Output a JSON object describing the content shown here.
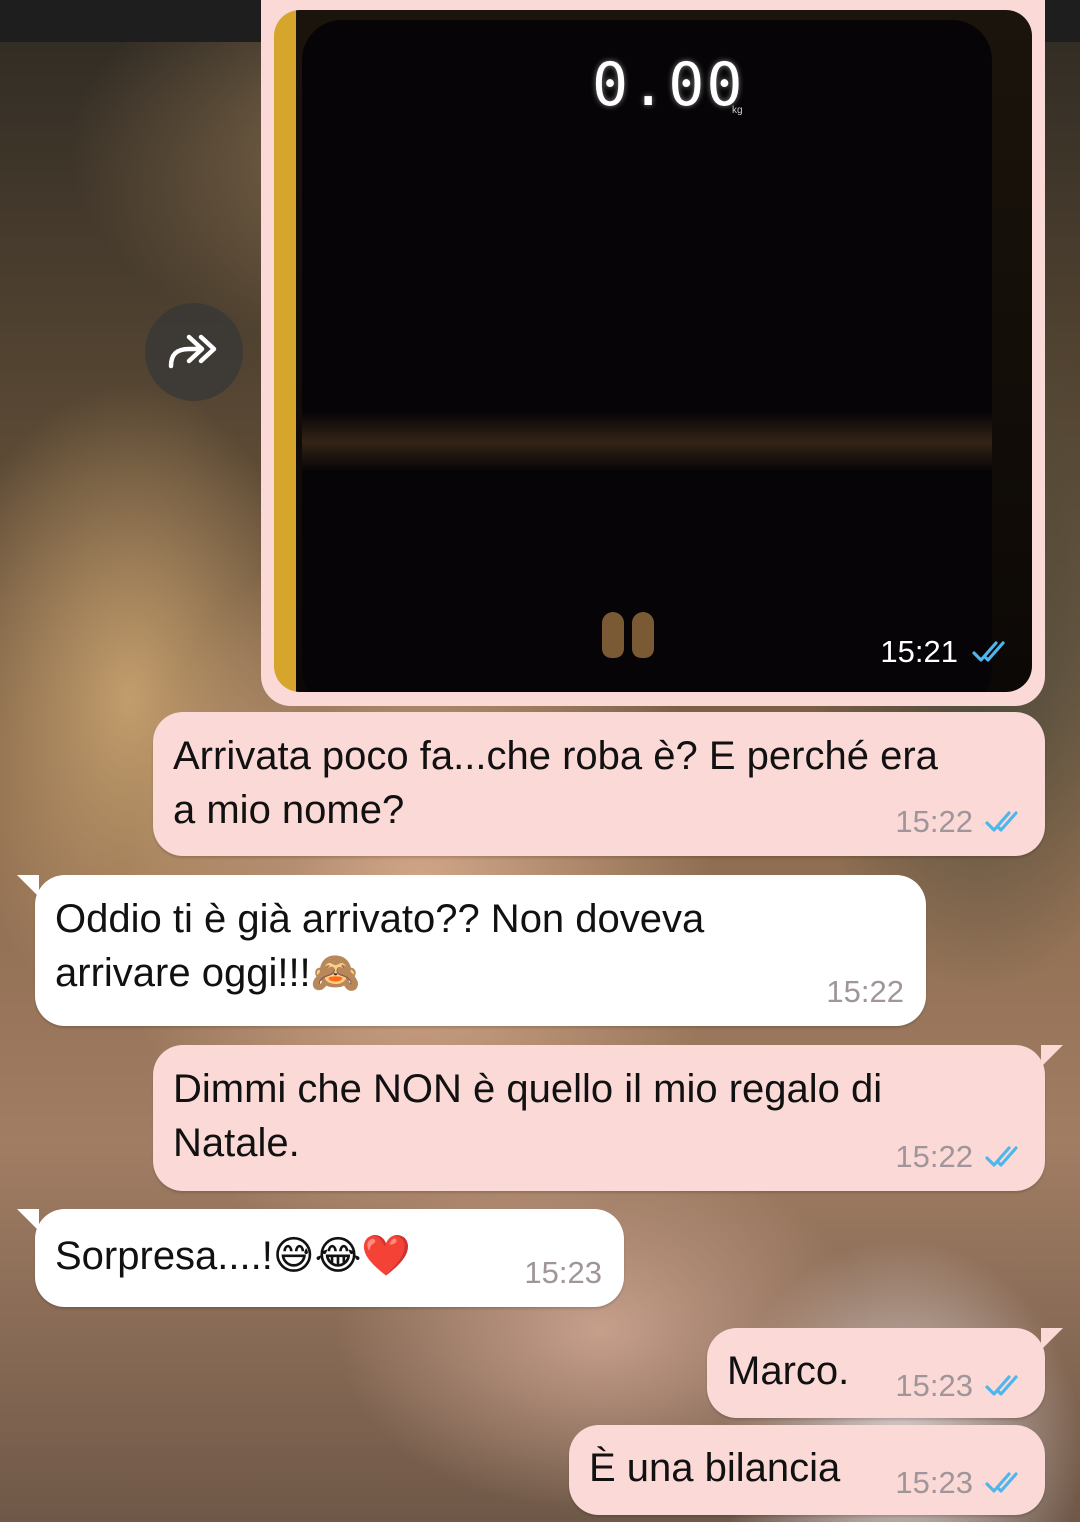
{
  "image_message": {
    "scale_readout": "0.00",
    "scale_unit": "kg",
    "time": "15:21",
    "status_icon": "double-check-icon"
  },
  "forward_button": {
    "icon": "forward-icon"
  },
  "messages": [
    {
      "id": "m1",
      "direction": "outgoing",
      "text": "Arrivata poco fa...che roba è? E perché era\na mio nome?",
      "time": "15:22",
      "status_icon": "double-check-icon"
    },
    {
      "id": "m2",
      "direction": "incoming",
      "text": "Oddio ti è già arrivato?? Non doveva\narrivare oggi!!!🙈",
      "time": "15:22"
    },
    {
      "id": "m3",
      "direction": "outgoing",
      "text": "Dimmi che NON è quello il mio regalo di\nNatale.",
      "time": "15:22",
      "status_icon": "double-check-icon"
    },
    {
      "id": "m4",
      "direction": "incoming",
      "text": "Sorpresa....!😅😂❤️",
      "time": "15:23"
    },
    {
      "id": "m5",
      "direction": "outgoing",
      "text": "Marco.",
      "time": "15:23",
      "status_icon": "double-check-icon"
    },
    {
      "id": "m6",
      "direction": "outgoing",
      "text": "È una bilancia",
      "time": "15:23",
      "status_icon": "double-check-icon"
    }
  ],
  "colors": {
    "outgoing_bubble": "#fbd9d7",
    "incoming_bubble": "#ffffff",
    "read_tick": "#4fb6ec",
    "timestamp": "#a0959a"
  }
}
